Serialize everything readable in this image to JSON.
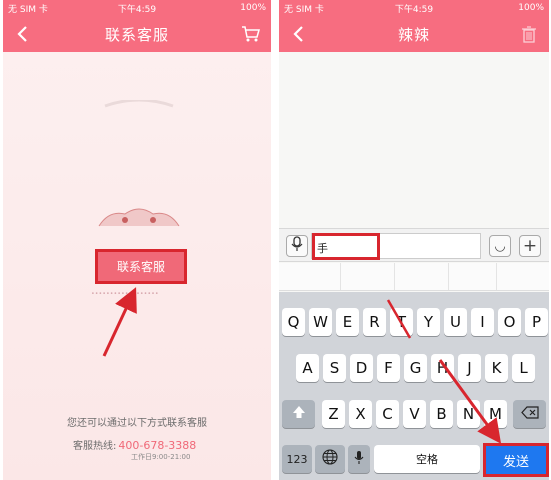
{
  "left": {
    "status": {
      "carrier": "无 SIM 卡",
      "time": "下午4:59",
      "battery": "100%"
    },
    "nav": {
      "title": "联系客服",
      "back_icon": "chevron-left-icon",
      "right_icon": "cart-icon"
    },
    "contact_button": "联系客服",
    "other_ways": "您还可以通过以下方式联系客服",
    "hotline_label": "客服热线:",
    "hotline_number": "400-678-3388",
    "hours": "工作日9:00-21:00"
  },
  "right": {
    "status": {
      "carrier": "无 SIM 卡",
      "time": "下午4:59",
      "battery": "100%"
    },
    "nav": {
      "title": "辣辣",
      "back_icon": "chevron-left-icon",
      "right_icon": "trash-icon"
    },
    "input": {
      "value": "手"
    },
    "emoji_label": "◡",
    "plus_label": "+",
    "keyboard": {
      "row1": [
        "Q",
        "W",
        "E",
        "R",
        "T",
        "Y",
        "U",
        "I",
        "O",
        "P"
      ],
      "row2": [
        "A",
        "S",
        "D",
        "F",
        "G",
        "H",
        "J",
        "K",
        "L"
      ],
      "row3": [
        "Z",
        "X",
        "C",
        "V",
        "B",
        "N",
        "M"
      ],
      "numbers_key": "123",
      "space_key": "空格",
      "send_key": "发送"
    }
  },
  "colors": {
    "brand": "#f76d80",
    "highlight": "#d8262e",
    "send": "#1e78f0"
  }
}
